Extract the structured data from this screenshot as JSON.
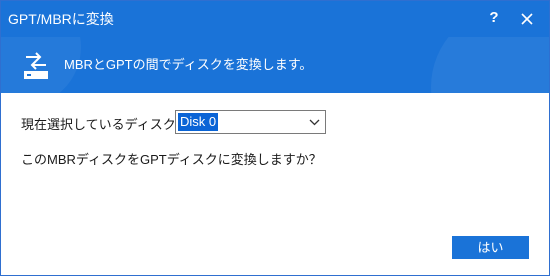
{
  "window": {
    "title": "GPT/MBRに変換",
    "help_label": "?",
    "close_icon": "close-icon"
  },
  "header": {
    "icon": "convert-arrows-drive-icon",
    "description": "MBRとGPTの間でディスクを変換します。"
  },
  "form": {
    "disk_label": "現在選択しているディスク：",
    "disk_selected": "Disk 0",
    "question": "このMBRディスクをGPTディスクに変換しますか？"
  },
  "actions": {
    "yes_label": "はい"
  },
  "colors": {
    "accent": "#1a73d8",
    "selection": "#0a64d6"
  }
}
